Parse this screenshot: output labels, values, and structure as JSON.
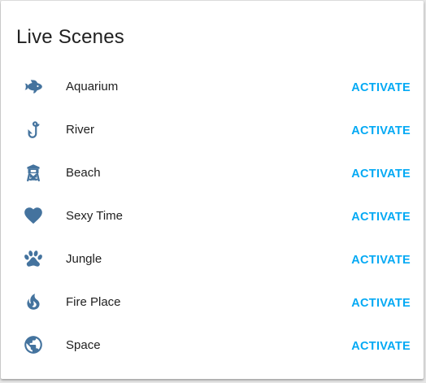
{
  "card": {
    "title": "Live Scenes"
  },
  "colors": {
    "icon": "#44739e",
    "accent": "#03a9f4",
    "text": "#212121"
  },
  "scenes": [
    {
      "name": "Aquarium",
      "icon": "fish-icon",
      "action": "ACTIVATE"
    },
    {
      "name": "River",
      "icon": "hook-icon",
      "action": "ACTIVATE"
    },
    {
      "name": "Beach",
      "icon": "lifeguard-tower-icon",
      "action": "ACTIVATE"
    },
    {
      "name": "Sexy Time",
      "icon": "heart-icon",
      "action": "ACTIVATE"
    },
    {
      "name": "Jungle",
      "icon": "paw-icon",
      "action": "ACTIVATE"
    },
    {
      "name": "Fire Place",
      "icon": "fire-icon",
      "action": "ACTIVATE"
    },
    {
      "name": "Space",
      "icon": "globe-icon",
      "action": "ACTIVATE"
    }
  ]
}
